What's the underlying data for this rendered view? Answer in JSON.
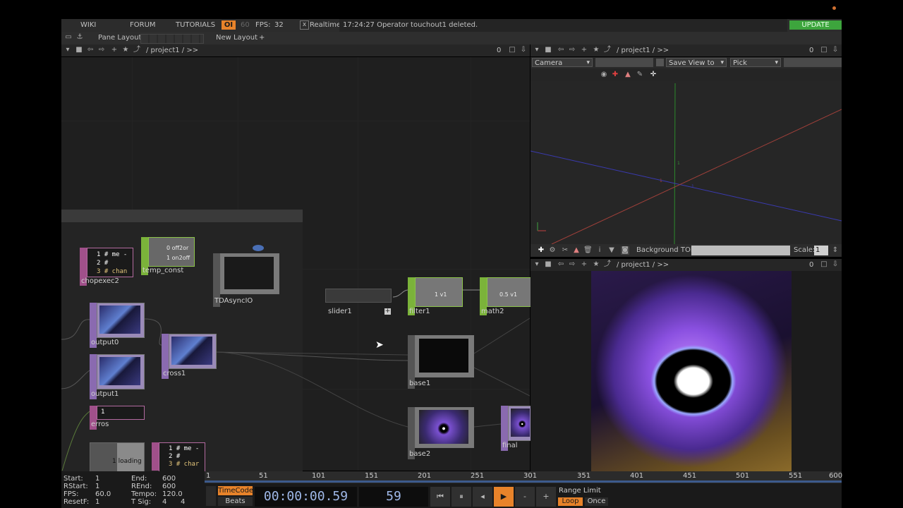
{
  "topbar": {
    "wiki": "WIKI",
    "forum": "FORUM",
    "tutorials": "TUTORIALS",
    "op_badge": "OI",
    "fps_cap": "60",
    "fps_label": "FPS:",
    "fps_value": "32",
    "realtime": "Realtime",
    "realtime_x": "x",
    "status": "17:24:27 Operator touchout1 deleted.",
    "update": "UPDATE"
  },
  "layoutbar": {
    "pane_layout": "Pane Layout",
    "new_layout": "New Layout",
    "add": "+"
  },
  "network": {
    "path": "/ project1 / >>",
    "count": "0",
    "nodes": {
      "chopexec2": {
        "label": "chopexec2",
        "lines": [
          "1 # me -",
          "2 #",
          "3 # chan"
        ]
      },
      "temp_const": {
        "label": "temp_const",
        "lines": [
          "0 off2or",
          "1 on2off"
        ]
      },
      "tdasyncio": {
        "label": "TDAsyncIO"
      },
      "slider1": {
        "label": "slider1"
      },
      "filter1": {
        "label": "filter1",
        "value": "1 v1"
      },
      "math2": {
        "label": "math2",
        "value": "0.5 v1"
      },
      "output0": {
        "label": "output0"
      },
      "cross1": {
        "label": "cross1"
      },
      "output1": {
        "label": "output1"
      },
      "base1": {
        "label": "base1"
      },
      "erros": {
        "label": "erros",
        "value": "1"
      },
      "base2": {
        "label": "base2"
      },
      "final": {
        "label": "final"
      },
      "loading": {
        "value": "1 loading"
      },
      "chopexec_bottom": {
        "lines": [
          "1 # me -",
          "2 #",
          "3 # char"
        ]
      }
    }
  },
  "viewer": {
    "path": "/ project1 / >>",
    "count": "0",
    "camera": "Camera",
    "save_view": "Save View to",
    "pick": "Pick",
    "axis_ticks": [
      "1",
      "1",
      "1"
    ]
  },
  "bgtop": {
    "label": "Background TOP:",
    "scale_label": "Scale:",
    "scale_value": "1"
  },
  "viewer2": {
    "path": "/ project1 / >>",
    "count": "0"
  },
  "timeline": {
    "ruler_ticks": [
      "1",
      "51",
      "101",
      "151",
      "201",
      "251",
      "301",
      "351",
      "401",
      "451",
      "501",
      "551",
      "600"
    ],
    "start_label": "Start:",
    "start": "1",
    "end_label": "End:",
    "end": "600",
    "rstart_label": "RStart:",
    "rstart": "1",
    "rend_label": "REnd:",
    "rend": "600",
    "fps_label": "FPS:",
    "fps": "60.0",
    "tempo_label": "Tempo:",
    "tempo": "120.0",
    "resetf_label": "ResetF:",
    "resetf": "1",
    "tsig_label": "T Sig:",
    "tsig_a": "4",
    "tsig_b": "4",
    "timecode_tab": "TimeCode",
    "beats_tab": "Beats",
    "timecode": "00:00:00.59",
    "frame": "59",
    "range_limit": "Range Limit",
    "loop": "Loop",
    "once": "Once",
    "minus": "-",
    "plus": "+"
  }
}
